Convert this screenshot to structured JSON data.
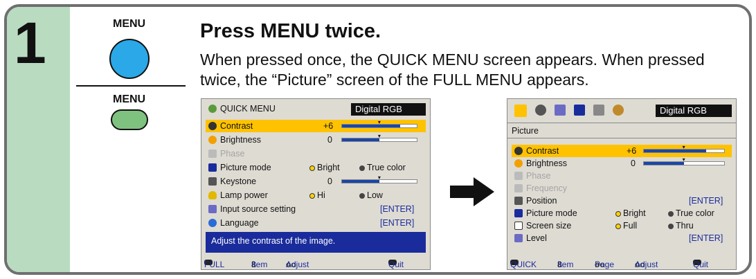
{
  "step": {
    "number": "1"
  },
  "buttons": {
    "menu_top_label": "MENU",
    "menu_bottom_label": "MENU"
  },
  "heading": "Press MENU twice.",
  "description": "When pressed once, the QUICK MENU screen appears. When pressed twice, the “Picture” screen of the FULL MENU appears.",
  "quick_menu": {
    "title": "QUICK MENU",
    "input": "Digital RGB",
    "items": [
      {
        "label": "Contrast",
        "value": "+6",
        "selected": true
      },
      {
        "label": "Brightness",
        "value": "0"
      },
      {
        "label": "Phase",
        "disabled": true
      },
      {
        "label": "Picture mode",
        "opt1": "Bright",
        "opt2": "True color"
      },
      {
        "label": "Keystone",
        "value": "0"
      },
      {
        "label": "Lamp power",
        "opt1": "Hi",
        "opt2": "Low"
      },
      {
        "label": "Input source setting",
        "action": "[ENTER]"
      },
      {
        "label": "Language",
        "action": "[ENTER]"
      }
    ],
    "help": "Adjust the contrast of the image.",
    "footer": {
      "full": "FULL",
      "item": "Item",
      "adjust": "Adjust",
      "quit": "Quit"
    },
    "bar_levels": {
      "contrast": 0.78,
      "brightness": 0.5,
      "keystone": 0.5
    }
  },
  "full_menu": {
    "input": "Digital RGB",
    "section": "Picture",
    "items": [
      {
        "label": "Contrast",
        "value": "+6",
        "selected": true
      },
      {
        "label": "Brightness",
        "value": "0"
      },
      {
        "label": "Phase",
        "disabled": true
      },
      {
        "label": "Frequency",
        "disabled": true
      },
      {
        "label": "Position",
        "action": "[ENTER]"
      },
      {
        "label": "Picture mode",
        "opt1": "Bright",
        "opt2": "True color"
      },
      {
        "label": "Screen size",
        "opt1": "Full",
        "opt2": "Thru"
      },
      {
        "label": "Level",
        "action": "[ENTER]"
      }
    ],
    "footer": {
      "quick": "QUICK",
      "item": "Item",
      "page": "Page",
      "adjust": "Adjust",
      "quit": "Quit"
    },
    "bar_levels": {
      "contrast": 0.78,
      "brightness": 0.5
    }
  },
  "colors": {
    "accent_blue": "#2aa8e8",
    "step_green": "#b9dcc0",
    "highlight": "#ffc200",
    "bar": "#1946a8"
  }
}
